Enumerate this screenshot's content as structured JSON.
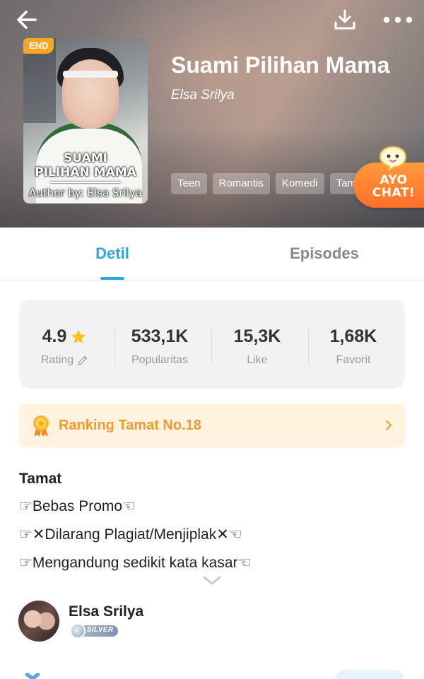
{
  "header": {
    "back_icon": "arrow-left-icon",
    "download_icon": "download-icon",
    "more_icon": "more-horizontal-icon"
  },
  "book": {
    "status_badge": "END",
    "title": "Suami Pilihan Mama",
    "author": "Elsa Srilya",
    "cover": {
      "title_line1": "SUAMI",
      "title_line2": "PILIHAN MAMA",
      "author_line": "Author by: Elsa Srilya"
    },
    "tags": [
      "Teen",
      "Romantis",
      "Komedi",
      "Tamat"
    ]
  },
  "chat_promo": {
    "line1": "AYO",
    "line2": "CHAT!"
  },
  "tabs": [
    {
      "label": "Detil",
      "active": true
    },
    {
      "label": "Episodes",
      "active": false
    }
  ],
  "stats": [
    {
      "value": "4.9",
      "label": "Rating"
    },
    {
      "value": "533,1K",
      "label": "Popularitas"
    },
    {
      "value": "15,3K",
      "label": "Like"
    },
    {
      "value": "1,68K",
      "label": "Favorit"
    }
  ],
  "ranking": {
    "label": "Ranking Tamat No.18"
  },
  "description": {
    "status": "Tamat",
    "lines": [
      "☞Bebas Promo☜",
      "☞✕Dilarang Plagiat/Menjiplak✕☜",
      "☞Mengandung sedikit kata kasar☜"
    ]
  },
  "author_profile": {
    "name": "Elsa Srilya",
    "level": "SILVER"
  },
  "colors": {
    "accent": "#2ea6e8",
    "badge": "#f6a623",
    "ranking_text": "#f39a2f",
    "ranking_bg": "#fff3e0",
    "chat": "#ff7a2e"
  }
}
